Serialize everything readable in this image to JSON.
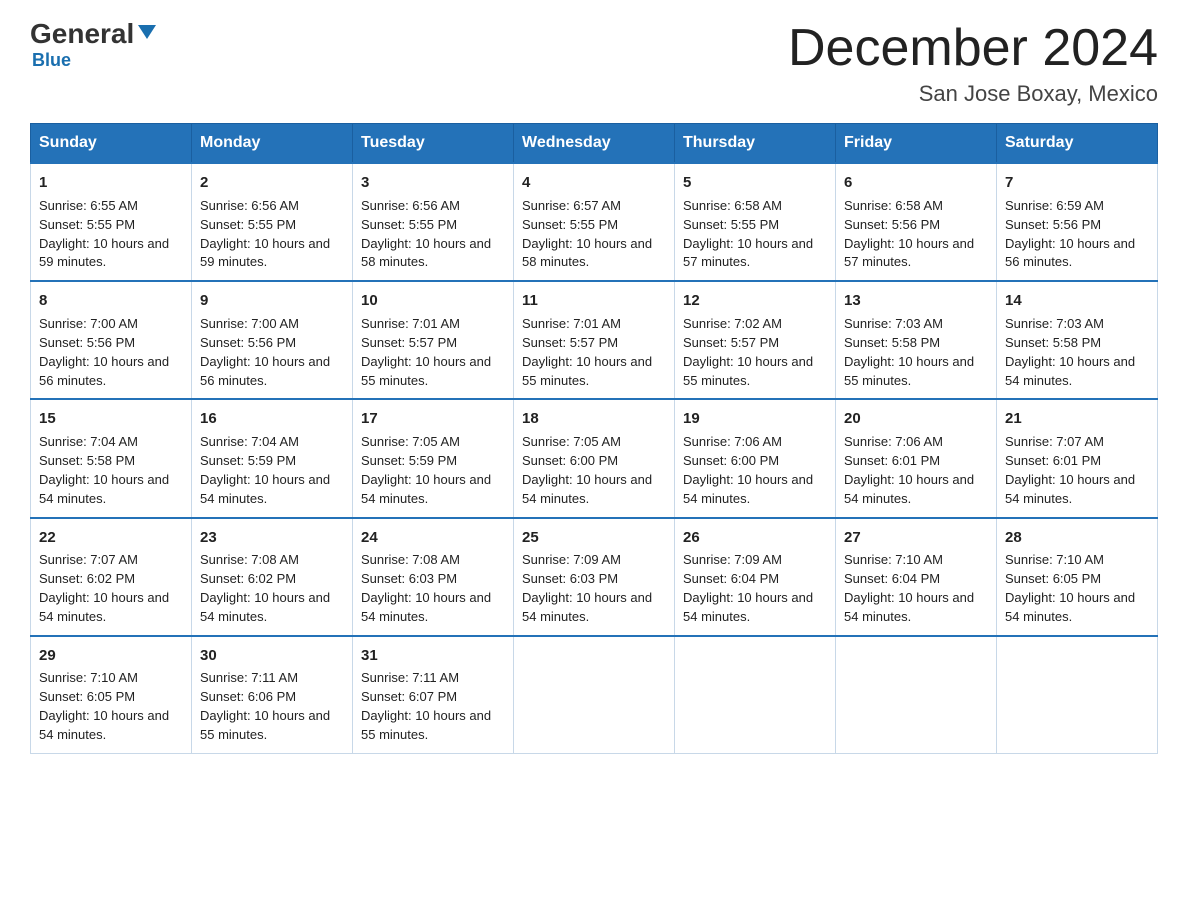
{
  "logo": {
    "name": "General",
    "name2": "Blue"
  },
  "title": "December 2024",
  "subtitle": "San Jose Boxay, Mexico",
  "days_of_week": [
    "Sunday",
    "Monday",
    "Tuesday",
    "Wednesday",
    "Thursday",
    "Friday",
    "Saturday"
  ],
  "weeks": [
    [
      {
        "day": "1",
        "sunrise": "6:55 AM",
        "sunset": "5:55 PM",
        "daylight": "10 hours and 59 minutes."
      },
      {
        "day": "2",
        "sunrise": "6:56 AM",
        "sunset": "5:55 PM",
        "daylight": "10 hours and 59 minutes."
      },
      {
        "day": "3",
        "sunrise": "6:56 AM",
        "sunset": "5:55 PM",
        "daylight": "10 hours and 58 minutes."
      },
      {
        "day": "4",
        "sunrise": "6:57 AM",
        "sunset": "5:55 PM",
        "daylight": "10 hours and 58 minutes."
      },
      {
        "day": "5",
        "sunrise": "6:58 AM",
        "sunset": "5:55 PM",
        "daylight": "10 hours and 57 minutes."
      },
      {
        "day": "6",
        "sunrise": "6:58 AM",
        "sunset": "5:56 PM",
        "daylight": "10 hours and 57 minutes."
      },
      {
        "day": "7",
        "sunrise": "6:59 AM",
        "sunset": "5:56 PM",
        "daylight": "10 hours and 56 minutes."
      }
    ],
    [
      {
        "day": "8",
        "sunrise": "7:00 AM",
        "sunset": "5:56 PM",
        "daylight": "10 hours and 56 minutes."
      },
      {
        "day": "9",
        "sunrise": "7:00 AM",
        "sunset": "5:56 PM",
        "daylight": "10 hours and 56 minutes."
      },
      {
        "day": "10",
        "sunrise": "7:01 AM",
        "sunset": "5:57 PM",
        "daylight": "10 hours and 55 minutes."
      },
      {
        "day": "11",
        "sunrise": "7:01 AM",
        "sunset": "5:57 PM",
        "daylight": "10 hours and 55 minutes."
      },
      {
        "day": "12",
        "sunrise": "7:02 AM",
        "sunset": "5:57 PM",
        "daylight": "10 hours and 55 minutes."
      },
      {
        "day": "13",
        "sunrise": "7:03 AM",
        "sunset": "5:58 PM",
        "daylight": "10 hours and 55 minutes."
      },
      {
        "day": "14",
        "sunrise": "7:03 AM",
        "sunset": "5:58 PM",
        "daylight": "10 hours and 54 minutes."
      }
    ],
    [
      {
        "day": "15",
        "sunrise": "7:04 AM",
        "sunset": "5:58 PM",
        "daylight": "10 hours and 54 minutes."
      },
      {
        "day": "16",
        "sunrise": "7:04 AM",
        "sunset": "5:59 PM",
        "daylight": "10 hours and 54 minutes."
      },
      {
        "day": "17",
        "sunrise": "7:05 AM",
        "sunset": "5:59 PM",
        "daylight": "10 hours and 54 minutes."
      },
      {
        "day": "18",
        "sunrise": "7:05 AM",
        "sunset": "6:00 PM",
        "daylight": "10 hours and 54 minutes."
      },
      {
        "day": "19",
        "sunrise": "7:06 AM",
        "sunset": "6:00 PM",
        "daylight": "10 hours and 54 minutes."
      },
      {
        "day": "20",
        "sunrise": "7:06 AM",
        "sunset": "6:01 PM",
        "daylight": "10 hours and 54 minutes."
      },
      {
        "day": "21",
        "sunrise": "7:07 AM",
        "sunset": "6:01 PM",
        "daylight": "10 hours and 54 minutes."
      }
    ],
    [
      {
        "day": "22",
        "sunrise": "7:07 AM",
        "sunset": "6:02 PM",
        "daylight": "10 hours and 54 minutes."
      },
      {
        "day": "23",
        "sunrise": "7:08 AM",
        "sunset": "6:02 PM",
        "daylight": "10 hours and 54 minutes."
      },
      {
        "day": "24",
        "sunrise": "7:08 AM",
        "sunset": "6:03 PM",
        "daylight": "10 hours and 54 minutes."
      },
      {
        "day": "25",
        "sunrise": "7:09 AM",
        "sunset": "6:03 PM",
        "daylight": "10 hours and 54 minutes."
      },
      {
        "day": "26",
        "sunrise": "7:09 AM",
        "sunset": "6:04 PM",
        "daylight": "10 hours and 54 minutes."
      },
      {
        "day": "27",
        "sunrise": "7:10 AM",
        "sunset": "6:04 PM",
        "daylight": "10 hours and 54 minutes."
      },
      {
        "day": "28",
        "sunrise": "7:10 AM",
        "sunset": "6:05 PM",
        "daylight": "10 hours and 54 minutes."
      }
    ],
    [
      {
        "day": "29",
        "sunrise": "7:10 AM",
        "sunset": "6:05 PM",
        "daylight": "10 hours and 54 minutes."
      },
      {
        "day": "30",
        "sunrise": "7:11 AM",
        "sunset": "6:06 PM",
        "daylight": "10 hours and 55 minutes."
      },
      {
        "day": "31",
        "sunrise": "7:11 AM",
        "sunset": "6:07 PM",
        "daylight": "10 hours and 55 minutes."
      },
      null,
      null,
      null,
      null
    ]
  ]
}
